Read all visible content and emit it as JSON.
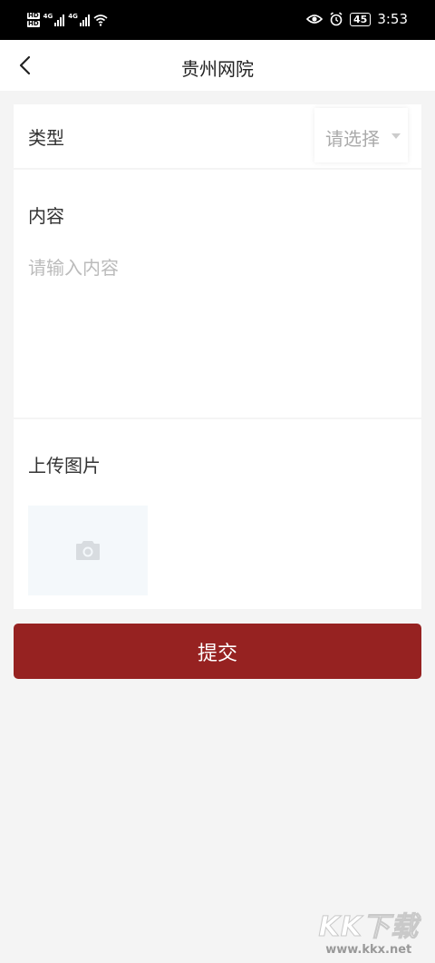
{
  "status_bar": {
    "hd_1": "HD",
    "hd_2": "HD",
    "network_1": "4G",
    "network_2": "4G",
    "battery": "45",
    "time": "3:53",
    "icons": [
      "signal-icon",
      "wifi-icon",
      "eye-icon",
      "alarm-icon",
      "battery-icon"
    ]
  },
  "nav": {
    "title": "贵州网院"
  },
  "form": {
    "type_label": "类型",
    "type_placeholder": "请选择",
    "content_label": "内容",
    "content_placeholder": "请输入内容",
    "upload_label": "上传图片"
  },
  "submit_label": "提交",
  "watermark": {
    "logo": "KK下载",
    "url": "www.kkx.net"
  },
  "colors": {
    "accent": "#962221",
    "background": "#f4f4f4",
    "upload_box": "#f4f8fb"
  }
}
